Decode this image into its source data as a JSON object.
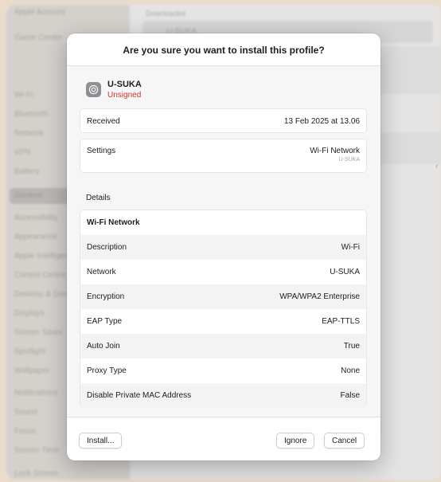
{
  "background": {
    "sidebar_items": [
      "Apple Account",
      "Game Center",
      "Wi-Fi",
      "Bluetooth",
      "Network",
      "VPN",
      "Battery",
      "General",
      "Accessibility",
      "Appearance",
      "Apple Intelligence",
      "Control Centre",
      "Desktop & Dock",
      "Displays",
      "Screen Saver",
      "Spotlight",
      "Wallpaper",
      "Notifications",
      "Sound",
      "Focus",
      "Screen Time",
      "Lock Screen"
    ],
    "selected_index": 7,
    "main_header": "Downloaded",
    "main_row": "U-SUKA"
  },
  "dialog": {
    "title": "Are you sure you want to install this profile?",
    "profile": {
      "name": "U-SUKA",
      "status": "Unsigned"
    },
    "received": {
      "label": "Received",
      "value": "13 Feb 2025 at 13.06"
    },
    "settings": {
      "label": "Settings",
      "value": "Wi-Fi Network",
      "sub": "U-SUKA"
    },
    "details_label": "Details",
    "details": {
      "header": "Wi-Fi Network",
      "rows": [
        {
          "label": "Description",
          "value": "Wi-Fi"
        },
        {
          "label": "Network",
          "value": "U-SUKA"
        },
        {
          "label": "Encryption",
          "value": "WPA/WPA2 Enterprise"
        },
        {
          "label": "EAP Type",
          "value": "EAP-TTLS"
        },
        {
          "label": "Auto Join",
          "value": "True"
        },
        {
          "label": "Proxy Type",
          "value": "None"
        },
        {
          "label": "Disable Private MAC Address",
          "value": "False"
        }
      ]
    },
    "buttons": {
      "install": "Install...",
      "ignore": "Ignore",
      "cancel": "Cancel"
    }
  },
  "colors": {
    "unsigned": "#d3322b",
    "desktop": "#e9dccd"
  }
}
